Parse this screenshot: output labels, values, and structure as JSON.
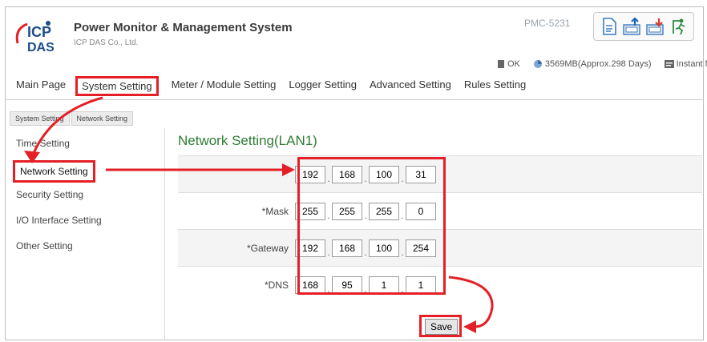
{
  "header": {
    "logo_text_top": "ICP",
    "logo_text_bottom": "DAS",
    "title": "Power Monitor & Management System",
    "company": "ICP DAS Co., Ltd.",
    "model": "PMC-5231"
  },
  "toolbar": {
    "icons": [
      "file-icon",
      "upload-icon",
      "download-icon",
      "logout-icon"
    ]
  },
  "status": {
    "ok_label": "OK",
    "storage_label": "3569MB(Approx.298 Days)",
    "message_label": "Instant Message"
  },
  "main_nav": {
    "items": [
      "Main Page",
      "System Setting",
      "Meter / Module Setting",
      "Logger Setting",
      "Advanced Setting",
      "Rules Setting"
    ]
  },
  "breadcrumb": [
    "System Setting",
    "Network Setting"
  ],
  "sidebar": {
    "items": [
      "Time Setting",
      "Network Setting",
      "Security Setting",
      "I/O Interface Setting",
      "Other Setting"
    ]
  },
  "section_title": "Network Setting(LAN1)",
  "network": {
    "rows": [
      {
        "label": "",
        "octets": [
          "192",
          "168",
          "100",
          "31"
        ]
      },
      {
        "label": "*Mask",
        "octets": [
          "255",
          "255",
          "255",
          "0"
        ]
      },
      {
        "label": "*Gateway",
        "octets": [
          "192",
          "168",
          "100",
          "254"
        ]
      },
      {
        "label": "*DNS",
        "octets": [
          "168",
          "95",
          "1",
          "1"
        ]
      }
    ]
  },
  "save_label": "Save",
  "colors": {
    "highlight": "#e41f26",
    "title_green": "#2e7d32",
    "logo_blue": "#1d4e89"
  }
}
